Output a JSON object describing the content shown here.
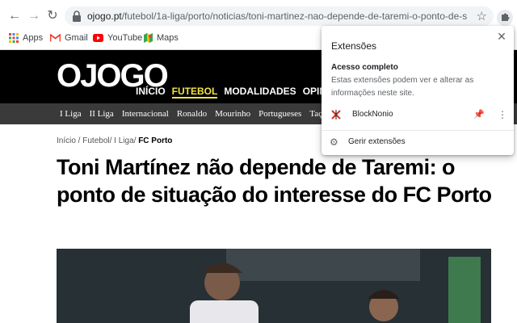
{
  "browser": {
    "back_icon": "arrow-left-icon",
    "forward_icon": "arrow-right-icon",
    "reload_icon": "reload-icon",
    "url_host": "ojogo.pt",
    "url_path": "/futebol/1a-liga/porto/noticias/toni-martinez-nao-depende-de-taremi-o-ponto-de-situacao-...",
    "bookmarks": [
      {
        "label": "Apps",
        "icon": "apps-grid-icon"
      },
      {
        "label": "Gmail",
        "icon": "gmail-icon"
      },
      {
        "label": "YouTube",
        "icon": "youtube-icon"
      },
      {
        "label": "Maps",
        "icon": "maps-icon"
      }
    ]
  },
  "site": {
    "logo": "OJOGO",
    "main_nav": [
      "INÍCIO",
      "FUTEBOL",
      "MODALIDADES",
      "OPINIÃO"
    ],
    "main_nav_active": "FUTEBOL",
    "sub_nav": [
      "I Liga",
      "II Liga",
      "Internacional",
      "Ronaldo",
      "Mourinho",
      "Portugueses",
      "Taça d"
    ]
  },
  "article": {
    "breadcrumb": [
      "Início",
      "Futebol",
      "I Liga"
    ],
    "breadcrumb_current": "FC Porto",
    "headline": "Toni Martínez não depende de Taremi: o ponto de situação do interesse do FC Porto"
  },
  "extensions_popup": {
    "title": "Extensões",
    "section_title": "Acesso completo",
    "section_desc": "Estas extensões podem ver e alterar as informações neste site.",
    "extension_name": "BlockNonio",
    "manage_label": "Gerir extensões"
  },
  "colors": {
    "brand_yellow": "#f4e542",
    "header_black": "#000000",
    "subnav_gray": "#3a3a3a"
  }
}
